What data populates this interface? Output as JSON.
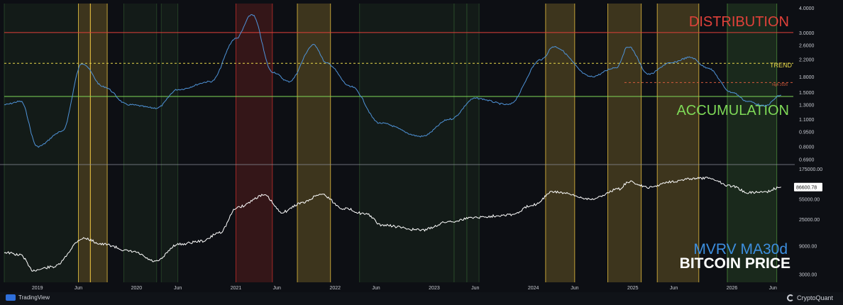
{
  "chart_data": [
    {
      "type": "line",
      "title": "MVRV MA30d",
      "scale": "log",
      "y_ticks": [
        "4.0000",
        "3.0000",
        "2.6000",
        "2.2000",
        "1.8000",
        "1.5000",
        "1.3000",
        "1.1000",
        "0.9500",
        "0.8000",
        "0.6900"
      ],
      "bands": [
        {
          "label": "DISTRIBUTION",
          "value": 3.0,
          "color": "#e0413a"
        },
        {
          "label": "TREND",
          "value": 2.1,
          "color": "#e8d84a"
        },
        {
          "label": "ACCUMULATION",
          "value": 1.43,
          "color": "#7ed957"
        },
        {
          "label": "high 2026",
          "value": 1.68,
          "color": "#d45b3c"
        }
      ],
      "series_color": "#4f93d8",
      "x": [
        "2018-09-01",
        "2018-11-01",
        "2019-01-01",
        "2019-04-01",
        "2019-06-15",
        "2019-09-01",
        "2019-12-01",
        "2020-03-15",
        "2020-06-01",
        "2020-10-01",
        "2021-01-01",
        "2021-03-01",
        "2021-05-15",
        "2021-07-15",
        "2021-10-15",
        "2021-12-01",
        "2022-03-01",
        "2022-06-15",
        "2022-11-15",
        "2023-03-01",
        "2023-06-01",
        "2023-10-01",
        "2024-02-01",
        "2024-03-15",
        "2024-08-01",
        "2024-11-01",
        "2024-12-15",
        "2025-03-01",
        "2025-05-15",
        "2025-08-01",
        "2025-10-01",
        "2026-01-01",
        "2026-03-01",
        "2026-05-01",
        "2026-07-01"
      ],
      "values": [
        1.3,
        1.35,
        0.8,
        0.95,
        2.1,
        1.6,
        1.3,
        1.25,
        1.55,
        1.7,
        2.8,
        3.7,
        1.9,
        1.7,
        2.6,
        2.1,
        1.6,
        1.05,
        0.9,
        1.1,
        1.4,
        1.3,
        2.2,
        2.55,
        1.8,
        2.0,
        2.55,
        1.85,
        2.1,
        2.25,
        2.0,
        1.5,
        1.35,
        1.28,
        1.45
      ]
    },
    {
      "type": "line",
      "title": "BITCOIN PRICE",
      "scale": "log",
      "last_value_label": "86600.78",
      "y_ticks": [
        "175000.00",
        "55000.00",
        "25000.00",
        "9000.00",
        "3000.00"
      ],
      "x_ticks": [
        "2019",
        "Jun",
        "2020",
        "Jun",
        "2021",
        "Jun",
        "2022",
        "Jun",
        "2023",
        "Jun",
        "2024",
        "Jun",
        "2025",
        "Jun",
        "2026",
        "Jun"
      ],
      "series_color": "#ffffff",
      "x": [
        "2018-09-01",
        "2018-11-01",
        "2018-12-15",
        "2019-03-01",
        "2019-06-20",
        "2019-09-01",
        "2019-12-15",
        "2020-03-12",
        "2020-06-01",
        "2020-09-01",
        "2020-11-01",
        "2021-01-08",
        "2021-04-14",
        "2021-06-20",
        "2021-09-01",
        "2021-11-10",
        "2022-02-01",
        "2022-05-01",
        "2022-06-18",
        "2022-11-15",
        "2023-03-01",
        "2023-06-01",
        "2023-10-15",
        "2024-01-01",
        "2024-03-14",
        "2024-08-05",
        "2024-11-10",
        "2024-12-17",
        "2025-03-01",
        "2025-05-20",
        "2025-08-14",
        "2025-10-06",
        "2026-01-01",
        "2026-03-01",
        "2026-05-01",
        "2026-07-01"
      ],
      "values": [
        7000,
        6300,
        3500,
        4000,
        12000,
        9500,
        7200,
        4900,
        9500,
        10800,
        15000,
        40000,
        63000,
        33000,
        47000,
        66000,
        38000,
        30000,
        20000,
        16500,
        23000,
        27000,
        30000,
        44000,
        72000,
        55000,
        80000,
        106000,
        85000,
        107000,
        120000,
        122000,
        90000,
        70000,
        72000,
        86600
      ]
    }
  ],
  "zones": [
    {
      "start": "2018-09-01",
      "end": "2019-06-01",
      "color": "#2a4a2a"
    },
    {
      "start": "2019-06-01",
      "end": "2019-07-15",
      "color": "#e8c040"
    },
    {
      "start": "2019-07-15",
      "end": "2019-09-15",
      "color": "#e8c040"
    },
    {
      "start": "2019-11-15",
      "end": "2020-03-15",
      "color": "#2a4a2a"
    },
    {
      "start": "2020-04-01",
      "end": "2020-06-01",
      "color": "#2a4a2a"
    },
    {
      "start": "2021-01-01",
      "end": "2021-05-15",
      "color": "#c0302a"
    },
    {
      "start": "2021-08-15",
      "end": "2021-12-15",
      "color": "#e8c040"
    },
    {
      "start": "2022-04-01",
      "end": "2023-03-15",
      "color": "#2a4a2a"
    },
    {
      "start": "2023-03-15",
      "end": "2023-05-01",
      "color": "#2a4a2a"
    },
    {
      "start": "2023-05-01",
      "end": "2023-06-15",
      "color": "#2a4a2a"
    },
    {
      "start": "2024-02-15",
      "end": "2024-06-01",
      "color": "#e8c040"
    },
    {
      "start": "2024-10-01",
      "end": "2025-02-01",
      "color": "#e8c040"
    },
    {
      "start": "2025-04-01",
      "end": "2025-09-01",
      "color": "#e8c040"
    },
    {
      "start": "2025-12-15",
      "end": "2026-06-15",
      "color": "#4a8a3a"
    }
  ],
  "legend": {
    "mvrv_label": "MVRV MA30d",
    "mvrv_color": "#3d8fe0",
    "price_label": "BITCOIN PRICE",
    "price_color": "#ffffff"
  },
  "footer": {
    "left": "TradingView",
    "right": "CryptoQuant"
  },
  "colors": {
    "background": "#0d0f14",
    "axis_text": "#c9ccd3"
  }
}
